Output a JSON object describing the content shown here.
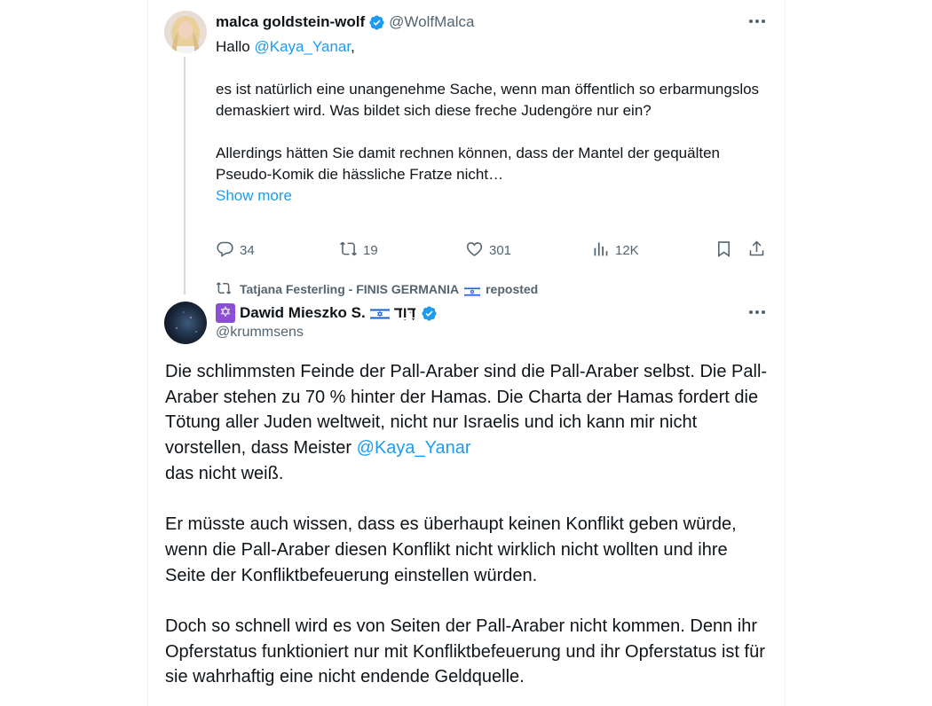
{
  "tweet1": {
    "name": "malca goldstein-wolf",
    "handle": "@WolfMalca",
    "greeting_prefix": "Hallo ",
    "mention": "@Kaya_Yanar",
    "greeting_suffix": ",",
    "paragraph1": "es ist natürlich eine unangenehme Sache, wenn man öffentlich so erbarmungslos demaskiert wird. Was bildet sich diese freche Judengöre nur ein?",
    "paragraph2": "Allerdings hätten Sie damit rechnen können, dass der Mantel der gequälten Pseudo-Komik die hässliche Fratze nicht…",
    "show_more": "Show more",
    "stats": {
      "replies": "34",
      "reposts": "19",
      "likes": "301",
      "views": "12K"
    }
  },
  "repost_banner": {
    "text": "Tatjana Festerling - FINIS GERMANIA",
    "suffix": "reposted"
  },
  "tweet2": {
    "name": "Dawid Mieszko S.",
    "name_hebrew": "דָּוִד",
    "handle": "@krummsens",
    "p1_before": "Die schlimmsten Feinde der Pall-Araber sind die Pall-Araber selbst. Die Pall-Araber stehen zu 70 % hinter der Hamas. Die Charta der Hamas fordert die Tötung aller Juden weltweit, nicht nur Israelis und ich kann mir nicht vorstellen, dass Meister ",
    "p1_mention": "@Kaya_Yanar",
    "p1_after": "das nicht weiß.",
    "p2": "Er müsste auch wissen, dass es überhaupt keinen Konflikt geben würde, wenn die Pall-Araber diesen Konflikt nicht wirklich nicht wollten und ihre Seite der Konfliktbefeuerung einstellen würden.",
    "p3": "Doch so schnell wird es von Seiten der Pall-Araber nicht kommen. Denn ihr Opferstatus funktioniert nur mit Konfliktbefeuerung und ihr Opferstatus ist für sie wahrhaftig eine nicht endende Geldquelle."
  },
  "icons": {
    "verified": "verified-badge-icon",
    "more": "more-options-icon",
    "reply": "reply-icon",
    "repost": "repost-icon",
    "like": "heart-icon",
    "views": "views-chart-icon",
    "bookmark": "bookmark-icon",
    "share": "share-icon",
    "star_of_david": "star-of-david-icon",
    "israel_flag": "israel-flag-icon"
  },
  "colors": {
    "accent": "#1d9bf0",
    "text": "#0f1419",
    "muted": "#536471",
    "border": "#eff3f4",
    "thread_line": "#cfd9de"
  }
}
